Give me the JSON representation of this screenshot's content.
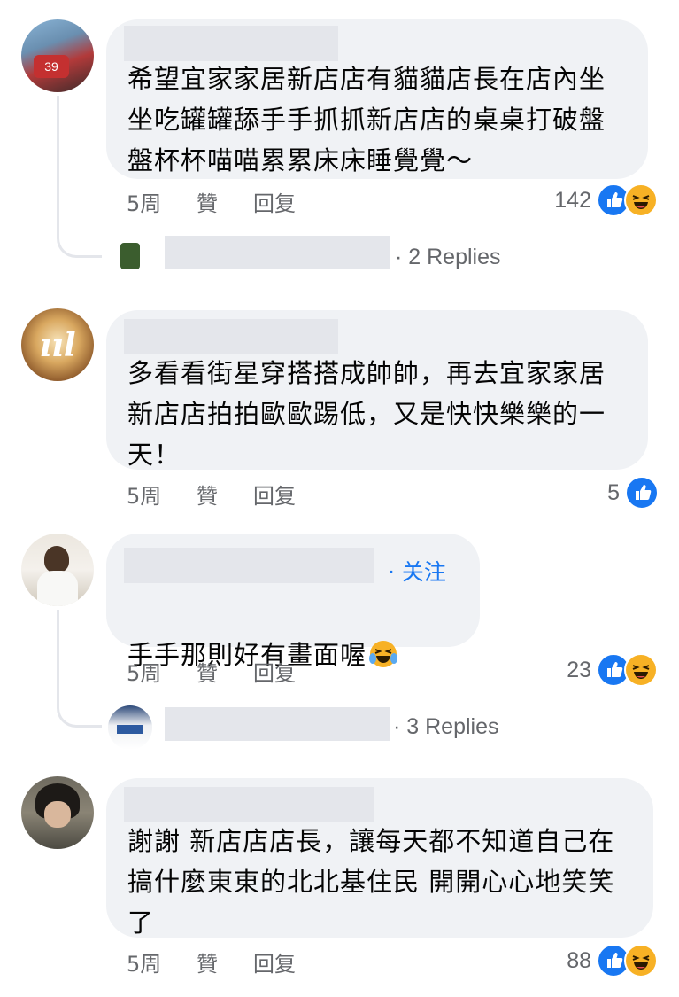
{
  "comments": [
    {
      "text": "希望宜家家居新店店有貓貓店長在店內坐\n坐吃罐罐舔手手抓抓新店店的桌桌打破盤\n盤杯杯喵喵累累床床睡覺覺～",
      "time": "5周",
      "like": "贊",
      "reply": "回复",
      "count": "142",
      "replies_text": "· 2 Replies"
    },
    {
      "text": "多看看街星穿搭搭成帥帥，再去宜家家居\n新店店拍拍歐歐踢低，又是快快樂樂的一\n天！",
      "time": "5周",
      "like": "贊",
      "reply": "回复",
      "count": "5"
    },
    {
      "text": "手手那則好有畫面喔",
      "follow": "· 关注",
      "time": "5周",
      "like": "贊",
      "reply": "回复",
      "count": "23",
      "replies_text": "· 3 Replies"
    },
    {
      "text": "謝謝 新店店店長，讓每天都不知道自己在\n搞什麼東東的北北基住民 開開心心地笑笑\n了",
      "time": "5周",
      "like": "贊",
      "reply": "回复",
      "count": "88"
    }
  ],
  "icons": {
    "like": "like-reaction-icon",
    "haha": "haha-reaction-icon",
    "emoji_in_text": "tears-of-joy-emoji"
  },
  "colors": {
    "like": "#1877f2",
    "haha": "#f7b125",
    "link": "#1877f2"
  }
}
